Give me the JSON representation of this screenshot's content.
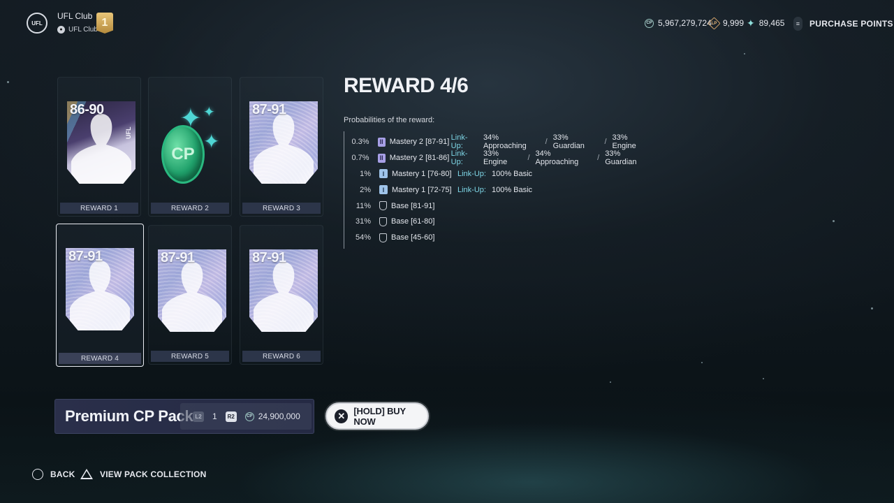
{
  "header": {
    "club_logo_text": "UFL",
    "club_name": "UFL Club",
    "club_sub": "UFL Club",
    "rank": "1",
    "currencies": [
      {
        "icon": "cp-coin-icon",
        "icon_text": "CP",
        "value": "5,967,279,724"
      },
      {
        "icon": "lp-icon",
        "icon_text": "LP",
        "value": "9,999"
      },
      {
        "icon": "sparkle-icon",
        "icon_text": "✦",
        "value": "89,465"
      }
    ],
    "purchase_points": "PURCHASE POINTS"
  },
  "rewards": [
    {
      "label": "REWARD 1",
      "rating": "86-90",
      "type": "player-special",
      "ufl_text": "UFL"
    },
    {
      "label": "REWARD 2",
      "rating": "",
      "type": "cp",
      "coin_text": "CP"
    },
    {
      "label": "REWARD 3",
      "rating": "87-91",
      "type": "player"
    },
    {
      "label": "REWARD 4",
      "rating": "87-91",
      "type": "player",
      "selected": true
    },
    {
      "label": "REWARD 5",
      "rating": "87-91",
      "type": "player"
    },
    {
      "label": "REWARD 6",
      "rating": "87-91",
      "type": "player"
    }
  ],
  "detail": {
    "title": "REWARD 4/6",
    "subtitle": "Probabilities of the reward:",
    "probabilities": [
      {
        "pct": "0.3%",
        "tier_icon": "II",
        "name": "Mastery 2 [87-91]",
        "linkup_label": "Link-Up:",
        "linkups": [
          "34% Approaching",
          "33% Guardian",
          "33% Engine"
        ]
      },
      {
        "pct": "0.7%",
        "tier_icon": "II",
        "name": "Mastery 2 [81-86]",
        "linkup_label": "Link-Up:",
        "linkups": [
          "33% Engine",
          "34% Approaching",
          "33% Guardian"
        ]
      },
      {
        "pct": "1%",
        "tier_icon": "I",
        "name": "Mastery 1 [76-80]",
        "linkup_label": "Link-Up:",
        "linkups": [
          "100% Basic"
        ]
      },
      {
        "pct": "2%",
        "tier_icon": "I",
        "name": "Mastery 1 [72-75]",
        "linkup_label": "Link-Up:",
        "linkups": [
          "100% Basic"
        ]
      },
      {
        "pct": "11%",
        "tier_icon": "",
        "name": "Base [81-91]",
        "linkup_label": "",
        "linkups": []
      },
      {
        "pct": "31%",
        "tier_icon": "",
        "name": "Base [61-80]",
        "linkup_label": "",
        "linkups": []
      },
      {
        "pct": "54%",
        "tier_icon": "",
        "name": "Base [45-60]",
        "linkup_label": "",
        "linkups": []
      }
    ]
  },
  "purchase": {
    "pack_name": "Premium CP Pack",
    "l2": "L2",
    "quantity": "1",
    "r2": "R2",
    "price_icon_text": "CP",
    "price": "24,900,000",
    "buy_label": "[HOLD] BUY NOW",
    "buy_icon": "✕"
  },
  "footer": {
    "back": "BACK",
    "view_collection": "VIEW PACK COLLECTION"
  }
}
